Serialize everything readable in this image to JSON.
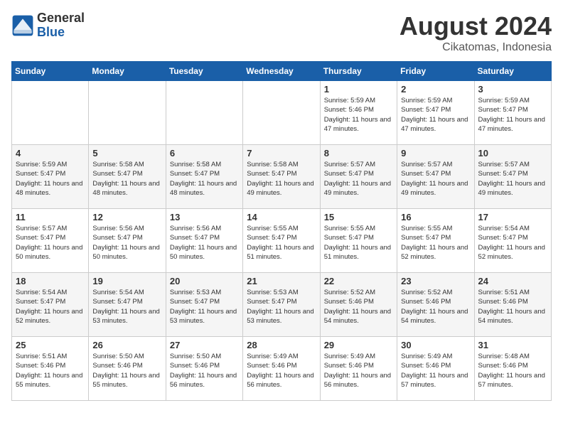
{
  "logo": {
    "general": "General",
    "blue": "Blue"
  },
  "title": "August 2024",
  "subtitle": "Cikatomas, Indonesia",
  "headers": [
    "Sunday",
    "Monday",
    "Tuesday",
    "Wednesday",
    "Thursday",
    "Friday",
    "Saturday"
  ],
  "weeks": [
    [
      {
        "day": "",
        "info": ""
      },
      {
        "day": "",
        "info": ""
      },
      {
        "day": "",
        "info": ""
      },
      {
        "day": "",
        "info": ""
      },
      {
        "day": "1",
        "info": "Sunrise: 5:59 AM\nSunset: 5:46 PM\nDaylight: 11 hours\nand 47 minutes."
      },
      {
        "day": "2",
        "info": "Sunrise: 5:59 AM\nSunset: 5:47 PM\nDaylight: 11 hours\nand 47 minutes."
      },
      {
        "day": "3",
        "info": "Sunrise: 5:59 AM\nSunset: 5:47 PM\nDaylight: 11 hours\nand 47 minutes."
      }
    ],
    [
      {
        "day": "4",
        "info": "Sunrise: 5:59 AM\nSunset: 5:47 PM\nDaylight: 11 hours\nand 48 minutes."
      },
      {
        "day": "5",
        "info": "Sunrise: 5:58 AM\nSunset: 5:47 PM\nDaylight: 11 hours\nand 48 minutes."
      },
      {
        "day": "6",
        "info": "Sunrise: 5:58 AM\nSunset: 5:47 PM\nDaylight: 11 hours\nand 48 minutes."
      },
      {
        "day": "7",
        "info": "Sunrise: 5:58 AM\nSunset: 5:47 PM\nDaylight: 11 hours\nand 49 minutes."
      },
      {
        "day": "8",
        "info": "Sunrise: 5:57 AM\nSunset: 5:47 PM\nDaylight: 11 hours\nand 49 minutes."
      },
      {
        "day": "9",
        "info": "Sunrise: 5:57 AM\nSunset: 5:47 PM\nDaylight: 11 hours\nand 49 minutes."
      },
      {
        "day": "10",
        "info": "Sunrise: 5:57 AM\nSunset: 5:47 PM\nDaylight: 11 hours\nand 49 minutes."
      }
    ],
    [
      {
        "day": "11",
        "info": "Sunrise: 5:57 AM\nSunset: 5:47 PM\nDaylight: 11 hours\nand 50 minutes."
      },
      {
        "day": "12",
        "info": "Sunrise: 5:56 AM\nSunset: 5:47 PM\nDaylight: 11 hours\nand 50 minutes."
      },
      {
        "day": "13",
        "info": "Sunrise: 5:56 AM\nSunset: 5:47 PM\nDaylight: 11 hours\nand 50 minutes."
      },
      {
        "day": "14",
        "info": "Sunrise: 5:55 AM\nSunset: 5:47 PM\nDaylight: 11 hours\nand 51 minutes."
      },
      {
        "day": "15",
        "info": "Sunrise: 5:55 AM\nSunset: 5:47 PM\nDaylight: 11 hours\nand 51 minutes."
      },
      {
        "day": "16",
        "info": "Sunrise: 5:55 AM\nSunset: 5:47 PM\nDaylight: 11 hours\nand 52 minutes."
      },
      {
        "day": "17",
        "info": "Sunrise: 5:54 AM\nSunset: 5:47 PM\nDaylight: 11 hours\nand 52 minutes."
      }
    ],
    [
      {
        "day": "18",
        "info": "Sunrise: 5:54 AM\nSunset: 5:47 PM\nDaylight: 11 hours\nand 52 minutes."
      },
      {
        "day": "19",
        "info": "Sunrise: 5:54 AM\nSunset: 5:47 PM\nDaylight: 11 hours\nand 53 minutes."
      },
      {
        "day": "20",
        "info": "Sunrise: 5:53 AM\nSunset: 5:47 PM\nDaylight: 11 hours\nand 53 minutes."
      },
      {
        "day": "21",
        "info": "Sunrise: 5:53 AM\nSunset: 5:47 PM\nDaylight: 11 hours\nand 53 minutes."
      },
      {
        "day": "22",
        "info": "Sunrise: 5:52 AM\nSunset: 5:46 PM\nDaylight: 11 hours\nand 54 minutes."
      },
      {
        "day": "23",
        "info": "Sunrise: 5:52 AM\nSunset: 5:46 PM\nDaylight: 11 hours\nand 54 minutes."
      },
      {
        "day": "24",
        "info": "Sunrise: 5:51 AM\nSunset: 5:46 PM\nDaylight: 11 hours\nand 54 minutes."
      }
    ],
    [
      {
        "day": "25",
        "info": "Sunrise: 5:51 AM\nSunset: 5:46 PM\nDaylight: 11 hours\nand 55 minutes."
      },
      {
        "day": "26",
        "info": "Sunrise: 5:50 AM\nSunset: 5:46 PM\nDaylight: 11 hours\nand 55 minutes."
      },
      {
        "day": "27",
        "info": "Sunrise: 5:50 AM\nSunset: 5:46 PM\nDaylight: 11 hours\nand 56 minutes."
      },
      {
        "day": "28",
        "info": "Sunrise: 5:49 AM\nSunset: 5:46 PM\nDaylight: 11 hours\nand 56 minutes."
      },
      {
        "day": "29",
        "info": "Sunrise: 5:49 AM\nSunset: 5:46 PM\nDaylight: 11 hours\nand 56 minutes."
      },
      {
        "day": "30",
        "info": "Sunrise: 5:49 AM\nSunset: 5:46 PM\nDaylight: 11 hours\nand 57 minutes."
      },
      {
        "day": "31",
        "info": "Sunrise: 5:48 AM\nSunset: 5:46 PM\nDaylight: 11 hours\nand 57 minutes."
      }
    ]
  ]
}
